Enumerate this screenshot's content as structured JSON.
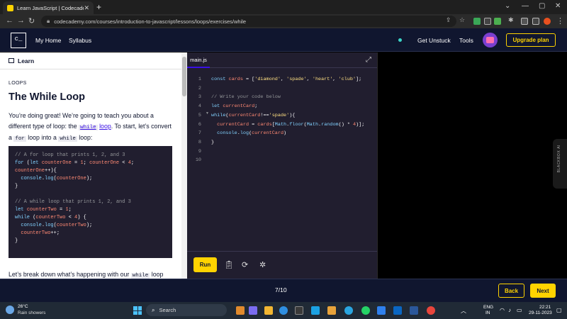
{
  "browser": {
    "tab_title": "Learn JavaScript | Codecademy",
    "url": "codecademy.com/courses/introduction-to-javascript/lessons/loops/exercises/while"
  },
  "header": {
    "logo": "c_",
    "nav": [
      "My Home",
      "Syllabus"
    ],
    "get_unstuck": "Get Unstuck",
    "tools": "Tools",
    "upgrade": "Upgrade plan"
  },
  "learn": {
    "header_label": "Learn",
    "kicker": "LOOPS",
    "title": "The While Loop",
    "para": {
      "p1": "You’re doing great! We’re going to teach you about a different type of loop: the ",
      "code1": "while",
      "link_word": "loop",
      "p2": ". To start, let’s convert a ",
      "code2": "for",
      "p3": " loop into a ",
      "code3": "while",
      "p4": " loop:"
    },
    "bottom": {
      "pre": "Let’s break down what’s happening with our ",
      "code": "while",
      "post": " loop"
    },
    "example_lines": [
      "// A for loop that prints 1, 2, and 3",
      "for (let counterOne = 1; counterOne < 4;",
      "counterOne++){",
      "  console.log(counterOne);",
      "}",
      "",
      "// A while loop that prints 1, 2, and 3",
      "let counterTwo = 1;",
      "while (counterTwo < 4) {",
      "  console.log(counterTwo);",
      "  counterTwo++;",
      "}"
    ]
  },
  "editor": {
    "file_tab": "main.js",
    "line_numbers": [
      "1",
      "2",
      "3",
      "4",
      "5",
      "6",
      "7",
      "8",
      "9",
      "10"
    ],
    "code_lines": [
      "const cards = ['diamond', 'spade', 'heart', 'club'];",
      "",
      "// Write your code below",
      "let currentCard;",
      "while(currentCard!=='spade'){",
      "  currentCard = cards[Math.floor(Math.random() * 4)];",
      "  console.log(currentCard)",
      "}",
      "",
      ""
    ],
    "run_label": "Run"
  },
  "output": {
    "side_tab": "BLACKBOX AI"
  },
  "footer": {
    "page": "7/10",
    "back": "Back",
    "next": "Next"
  },
  "taskbar": {
    "temp": "26°C",
    "condition": "Rain showers",
    "search_placeholder": "Search",
    "lang_line1": "ENG",
    "lang_line2": "IN",
    "time": "22:21",
    "date": "29-11-2023"
  },
  "colors": {
    "brand_navy": "#10162f",
    "accent_yellow": "#ffd300",
    "editor_bg": "#211e2f",
    "link_purple": "#3a10e5"
  }
}
